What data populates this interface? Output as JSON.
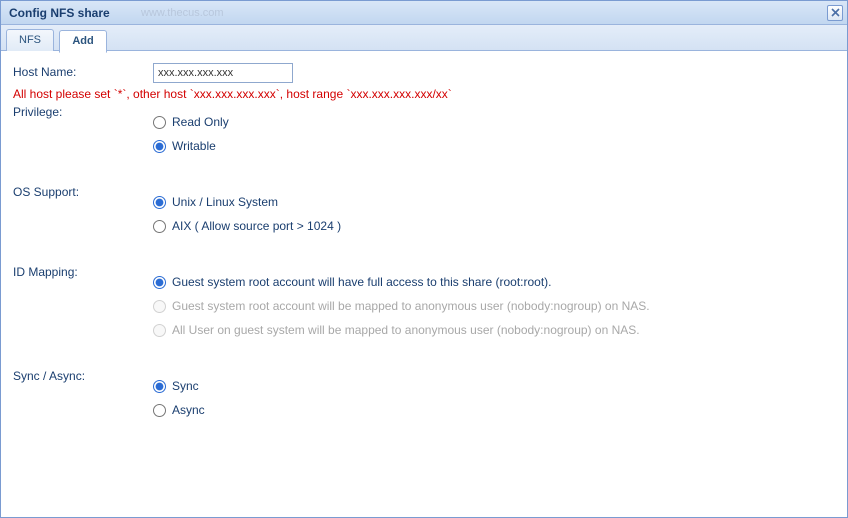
{
  "window": {
    "title": "Config NFS share",
    "watermark": "www.thecus.com",
    "right_text": ""
  },
  "tabs": {
    "nfs": "NFS",
    "add": "Add"
  },
  "form": {
    "hostname_label": "Host Name:",
    "hostname_value": "xxx.xxx.xxx.xxx",
    "hint": "All host please set `*`, other host `xxx.xxx.xxx.xxx`, host range `xxx.xxx.xxx.xxx/xx`",
    "privilege_label": "Privilege:",
    "privilege": {
      "readonly": "Read Only",
      "writable": "Writable",
      "selected": "writable"
    },
    "os_label": "OS Support:",
    "os": {
      "unix": "Unix / Linux System",
      "aix": "AIX ( Allow source port > 1024 )",
      "selected": "unix"
    },
    "idmap_label": "ID Mapping:",
    "idmap": {
      "root": "Guest system root account will have full access to this share (root:root).",
      "anon_root": "Guest system root account will be mapped to anonymous user (nobody:nogroup) on NAS.",
      "anon_all": "All User on guest system will be mapped to anonymous user (nobody:nogroup) on NAS.",
      "selected": "root"
    },
    "sync_label": "Sync / Async:",
    "sync": {
      "sync": "Sync",
      "async": "Async",
      "selected": "sync"
    }
  }
}
